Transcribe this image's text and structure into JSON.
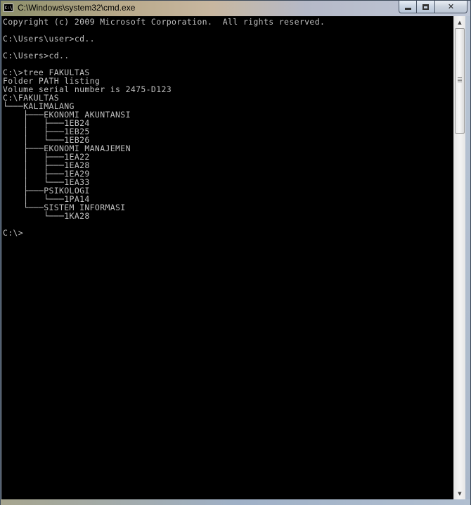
{
  "window": {
    "title": "C:\\Windows\\system32\\cmd.exe",
    "icon_label": "C:\\"
  },
  "caption_buttons": {
    "minimize": "minimize-icon",
    "maximize": "maximize-icon",
    "close": "✕"
  },
  "console": {
    "lines": [
      "Copyright (c) 2009 Microsoft Corporation.  All rights reserved.",
      "",
      "C:\\Users\\user>cd..",
      "",
      "C:\\Users>cd..",
      "",
      "C:\\>tree FAKULTAS",
      "Folder PATH listing",
      "Volume serial number is 2475-D123",
      "C:\\FAKULTAS",
      "└───KALIMALANG",
      "    ├───EKONOMI AKUNTANSI",
      "    │   ├───1EB24",
      "    │   ├───1EB25",
      "    │   └───1EB26",
      "    ├───EKONOMI MANAJEMEN",
      "    │   ├───1EA22",
      "    │   ├───1EA28",
      "    │   ├───1EA29",
      "    │   └───1EA33",
      "    ├───PSIKOLOGI",
      "    │   └───1PA14",
      "    └───SISTEM INFORMASI",
      "        └───1KA28",
      "",
      "C:\\>"
    ]
  },
  "scrollbar": {
    "up_arrow": "▲",
    "down_arrow": "▼"
  }
}
